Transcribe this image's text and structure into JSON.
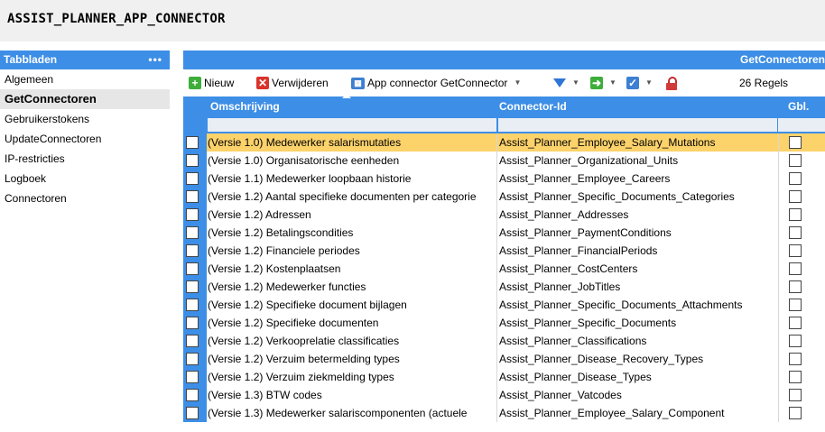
{
  "window": {
    "title": "ASSIST_PLANNER_APP_CONNECTOR"
  },
  "sidebar": {
    "header": "Tabbladen",
    "menu_dots": "•••",
    "items": [
      {
        "label": "Algemeen",
        "active": false
      },
      {
        "label": "GetConnectoren",
        "active": true
      },
      {
        "label": "Gebruikerstokens",
        "active": false
      },
      {
        "label": "UpdateConnectoren",
        "active": false
      },
      {
        "label": "IP-restricties",
        "active": false
      },
      {
        "label": "Logboek",
        "active": false
      },
      {
        "label": "Connectoren",
        "active": false
      }
    ]
  },
  "main": {
    "header": "GetConnectoren",
    "toolbar": {
      "new_label": "Nieuw",
      "delete_label": "Verwijderen",
      "app_connector_label": "App connector GetConnector",
      "row_count": "26 Regels"
    },
    "columns": {
      "description": "Omschrijving",
      "connector_id": "Connector-Id",
      "global": "Gbl."
    },
    "rows": [
      {
        "description": "(Versie 1.0) Medewerker salarismutaties",
        "connector_id": "Assist_Planner_Employee_Salary_Mutations",
        "selected": true
      },
      {
        "description": "(Versie 1.0) Organisatorische eenheden",
        "connector_id": "Assist_Planner_Organizational_Units",
        "selected": false
      },
      {
        "description": "(Versie 1.1) Medewerker loopbaan historie",
        "connector_id": "Assist_Planner_Employee_Careers",
        "selected": false
      },
      {
        "description": "(Versie 1.2) Aantal specifieke documenten per categorie",
        "connector_id": "Assist_Planner_Specific_Documents_Categories",
        "selected": false
      },
      {
        "description": "(Versie 1.2) Adressen",
        "connector_id": "Assist_Planner_Addresses",
        "selected": false
      },
      {
        "description": "(Versie 1.2) Betalingscondities",
        "connector_id": "Assist_Planner_PaymentConditions",
        "selected": false
      },
      {
        "description": "(Versie 1.2) Financiele periodes",
        "connector_id": "Assist_Planner_FinancialPeriods",
        "selected": false
      },
      {
        "description": "(Versie 1.2) Kostenplaatsen",
        "connector_id": "Assist_Planner_CostCenters",
        "selected": false
      },
      {
        "description": "(Versie 1.2) Medewerker functies",
        "connector_id": "Assist_Planner_JobTitles",
        "selected": false
      },
      {
        "description": "(Versie 1.2) Specifieke document bijlagen",
        "connector_id": "Assist_Planner_Specific_Documents_Attachments",
        "selected": false
      },
      {
        "description": "(Versie 1.2) Specifieke documenten",
        "connector_id": "Assist_Planner_Specific_Documents",
        "selected": false
      },
      {
        "description": "(Versie 1.2) Verkooprelatie classificaties",
        "connector_id": "Assist_Planner_Classifications",
        "selected": false
      },
      {
        "description": "(Versie 1.2) Verzuim betermelding types",
        "connector_id": "Assist_Planner_Disease_Recovery_Types",
        "selected": false
      },
      {
        "description": "(Versie 1.2) Verzuim ziekmelding types",
        "connector_id": "Assist_Planner_Disease_Types",
        "selected": false
      },
      {
        "description": "(Versie 1.3) BTW codes",
        "connector_id": "Assist_Planner_Vatcodes",
        "selected": false
      },
      {
        "description": "(Versie 1.3) Medewerker salariscomponenten (actuele",
        "connector_id": "Assist_Planner_Employee_Salary_Component",
        "selected": false
      }
    ]
  }
}
